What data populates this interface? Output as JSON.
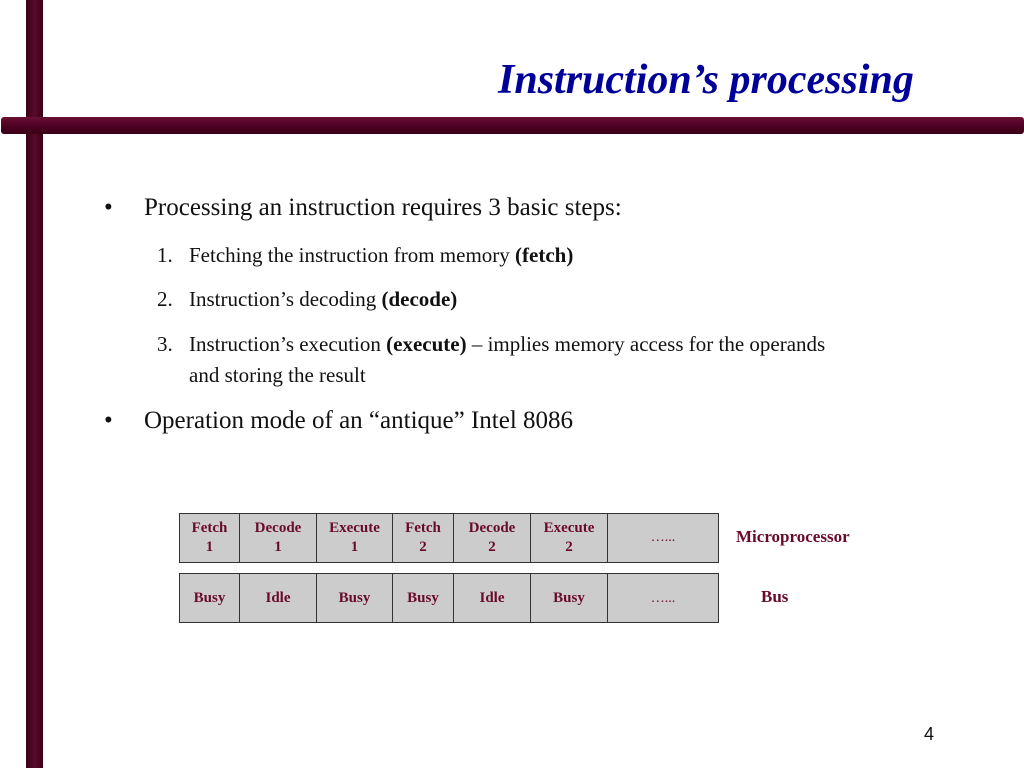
{
  "slide": {
    "title": "Instruction’s processing",
    "page_number": "4",
    "accent_color": "#4a0020",
    "title_color": "#000099",
    "diagram_text_color": "#6a0a2a"
  },
  "bullets": [
    {
      "marker": "•",
      "text": "Processing an instruction requires 3 basic steps:",
      "steps": [
        {
          "num": "1.",
          "text": "Fetching the instruction from memory ",
          "bold": "(fetch)",
          "after": ""
        },
        {
          "num": "2.",
          "text": "Instruction’s decoding ",
          "bold": "(decode)",
          "after": ""
        },
        {
          "num": "3.",
          "text": "Instruction’s execution ",
          "bold": "(execute)",
          "after": " – implies memory access for the operands",
          "continuation": "and storing the result"
        }
      ]
    },
    {
      "marker": "•",
      "text": "Operation mode of  an “antique” Intel 8086"
    }
  ],
  "diagram": {
    "microprocessor_row": {
      "label": "Microprocessor",
      "cells": [
        {
          "line1": "Fetch",
          "line2": "1"
        },
        {
          "line1": "Decode",
          "line2": "1"
        },
        {
          "line1": "Execute",
          "line2": "1"
        },
        {
          "line1": "Fetch",
          "line2": "2"
        },
        {
          "line1": "Decode",
          "line2": "2"
        },
        {
          "line1": "Execute",
          "line2": "2"
        },
        {
          "line1": "…...",
          "line2": ""
        }
      ]
    },
    "bus_row": {
      "label": "Bus",
      "cells": [
        "Busy",
        "Idle",
        "Busy",
        "Busy",
        "Idle",
        "Busy",
        "…..."
      ]
    }
  }
}
